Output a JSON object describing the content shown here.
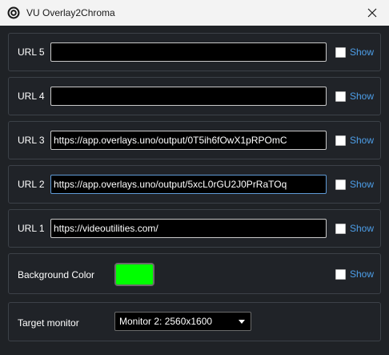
{
  "window": {
    "title": "VU Overlay2Chroma"
  },
  "colors": {
    "accent": "#4d9ee8",
    "background_color": "#00ff00"
  },
  "rows": [
    {
      "label": "URL 5",
      "value": "",
      "show_label": "Show",
      "show_checked": false
    },
    {
      "label": "URL 4",
      "value": "",
      "show_label": "Show",
      "show_checked": false
    },
    {
      "label": "URL 3",
      "value": "https://app.overlays.uno/output/0T5ih6fOwX1pRPOmC",
      "show_label": "Show",
      "show_checked": false
    },
    {
      "label": "URL 2",
      "value": "https://app.overlays.uno/output/5xcL0rGU2J0PrRaTOq",
      "show_label": "Show",
      "show_checked": false
    },
    {
      "label": "URL 1",
      "value": "https://videoutilities.com/",
      "show_label": "Show",
      "show_checked": false
    }
  ],
  "background": {
    "label": "Background Color",
    "show_label": "Show",
    "show_checked": false
  },
  "monitor": {
    "label": "Target monitor",
    "selected": "Monitor 2: 2560x1600"
  }
}
